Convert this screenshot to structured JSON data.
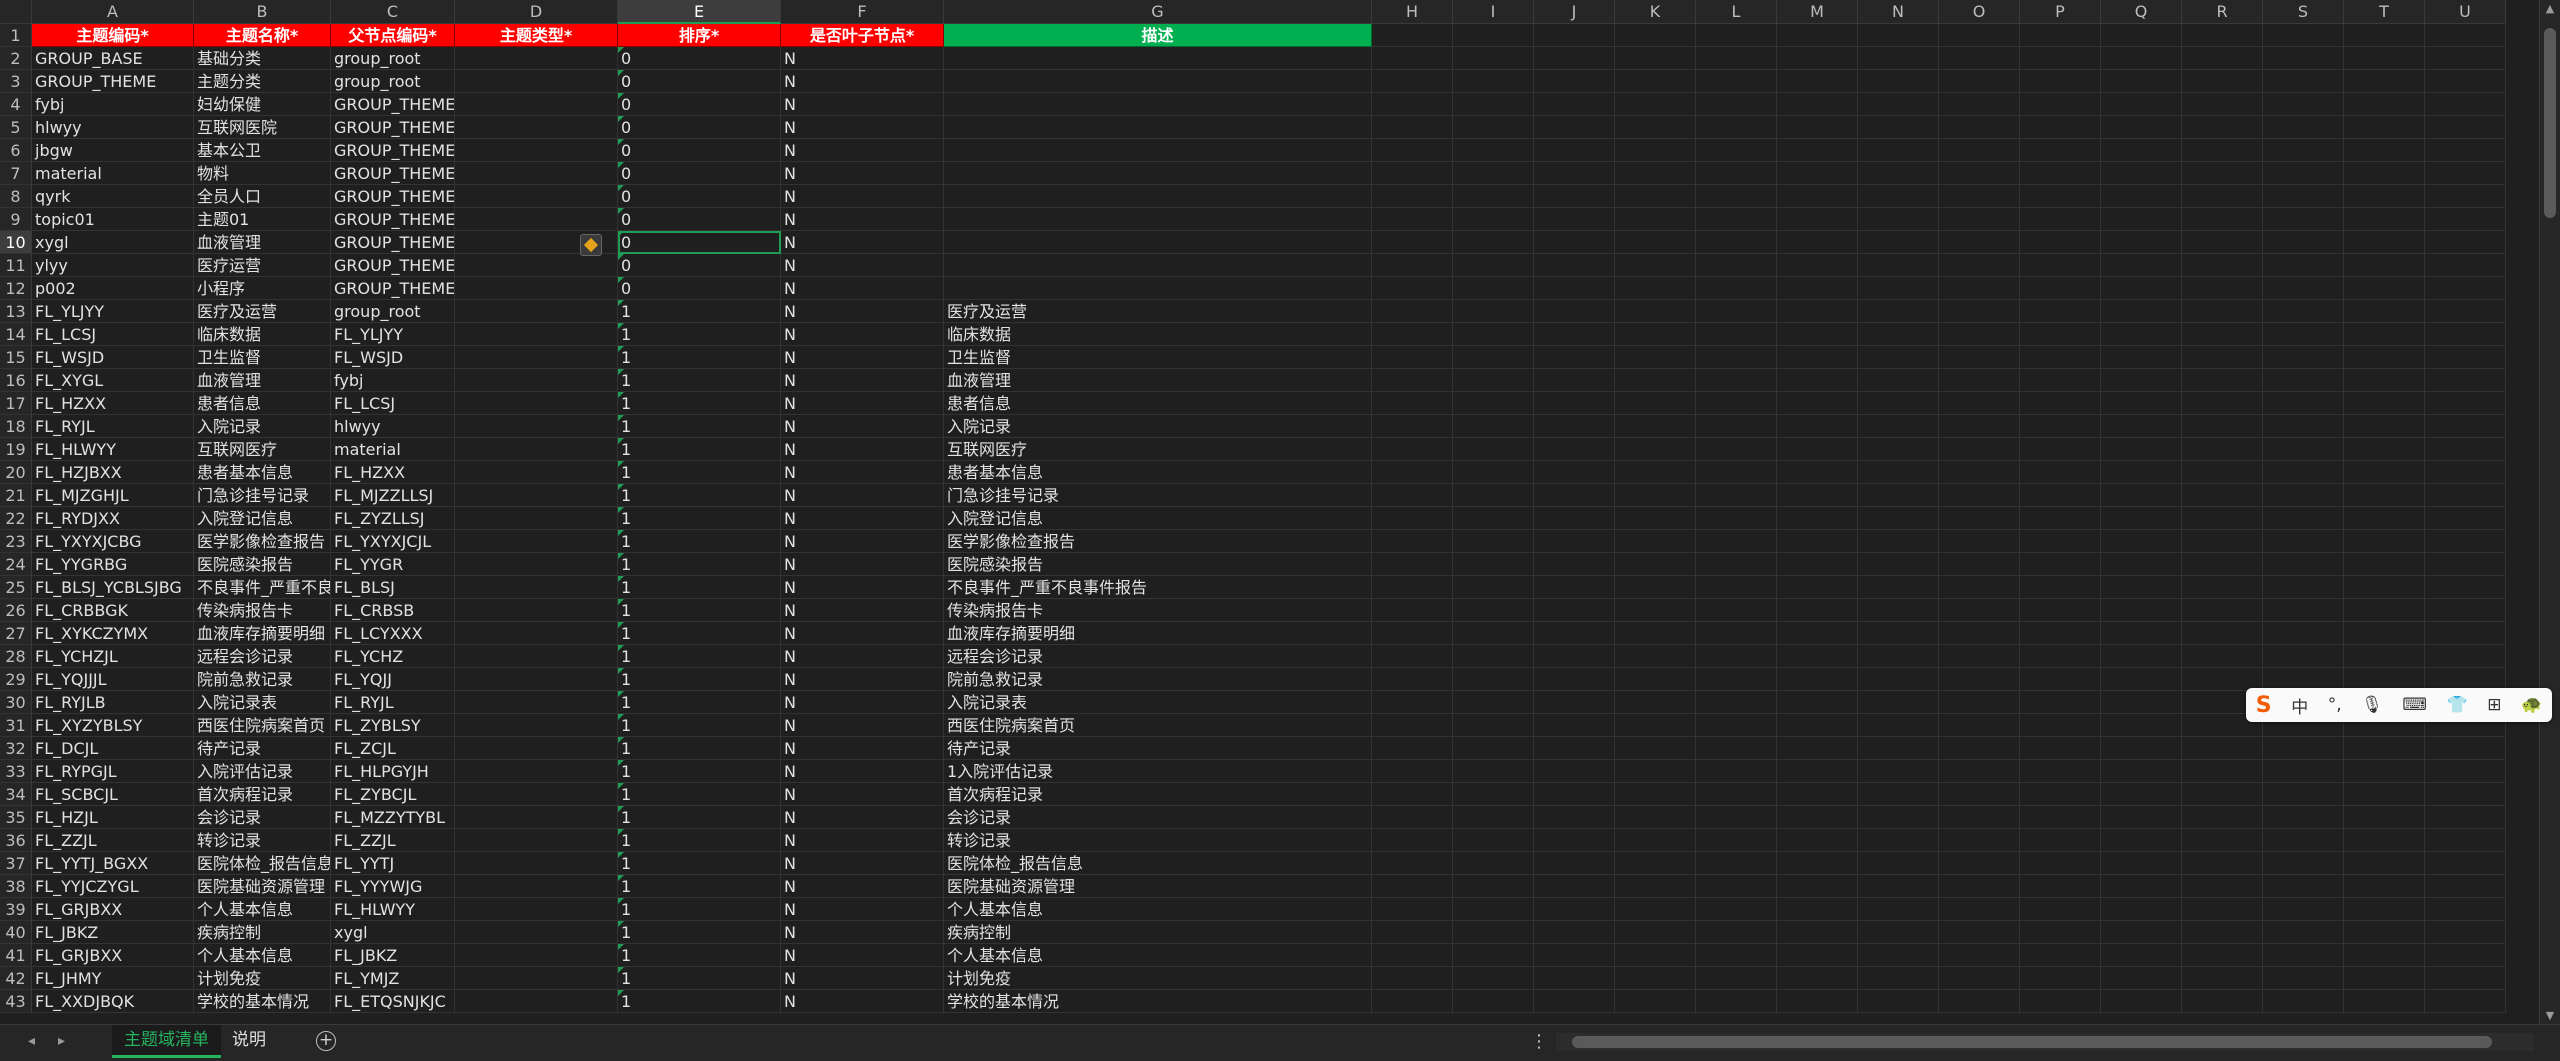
{
  "columns": [
    "A",
    "B",
    "C",
    "D",
    "E",
    "F",
    "G",
    "H",
    "I",
    "J",
    "K",
    "L",
    "M",
    "N",
    "O",
    "P",
    "Q",
    "R",
    "S",
    "T",
    "U"
  ],
  "selected_col": "E",
  "selected_row": "10",
  "header_row": {
    "num": "1",
    "cells": [
      "主题编码*",
      "主题名称*",
      "父节点编码*",
      "主题类型*",
      "排序*",
      "是否叶子节点*",
      "描述"
    ]
  },
  "rows": [
    {
      "n": "2",
      "a": "GROUP_BASE",
      "b": "基础分类",
      "c": "group_root",
      "d": "",
      "e": "0",
      "f": "N",
      "g": ""
    },
    {
      "n": "3",
      "a": "GROUP_THEME",
      "b": "主题分类",
      "c": "group_root",
      "d": "",
      "e": "0",
      "f": "N",
      "g": ""
    },
    {
      "n": "4",
      "a": "fybj",
      "b": "妇幼保健",
      "c": "GROUP_THEME",
      "d": "",
      "e": "0",
      "f": "N",
      "g": ""
    },
    {
      "n": "5",
      "a": "hlwyy",
      "b": "互联网医院",
      "c": "GROUP_THEME",
      "d": "",
      "e": "0",
      "f": "N",
      "g": ""
    },
    {
      "n": "6",
      "a": "jbgw",
      "b": "基本公卫",
      "c": "GROUP_THEME",
      "d": "",
      "e": "0",
      "f": "N",
      "g": ""
    },
    {
      "n": "7",
      "a": "material",
      "b": "物料",
      "c": "GROUP_THEME",
      "d": "",
      "e": "0",
      "f": "N",
      "g": ""
    },
    {
      "n": "8",
      "a": "qyrk",
      "b": "全员人口",
      "c": "GROUP_THEME",
      "d": "",
      "e": "0",
      "f": "N",
      "g": ""
    },
    {
      "n": "9",
      "a": "topic01",
      "b": "主题01",
      "c": "GROUP_THEME",
      "d": "",
      "e": "0",
      "f": "N",
      "g": ""
    },
    {
      "n": "10",
      "a": "xygl",
      "b": "血液管理",
      "c": "GROUP_THEME",
      "d": "",
      "e": "0",
      "f": "N",
      "g": ""
    },
    {
      "n": "11",
      "a": "ylyy",
      "b": "医疗运营",
      "c": "GROUP_THEME",
      "d": "",
      "e": "0",
      "f": "N",
      "g": ""
    },
    {
      "n": "12",
      "a": "p002",
      "b": "小程序",
      "c": "GROUP_THEME",
      "d": "",
      "e": "0",
      "f": "N",
      "g": ""
    },
    {
      "n": "13",
      "a": "FL_YLJYY",
      "b": "医疗及运营",
      "c": "group_root",
      "d": "",
      "e": "1",
      "f": "N",
      "g": "医疗及运营"
    },
    {
      "n": "14",
      "a": "FL_LCSJ",
      "b": "临床数据",
      "c": "FL_YLJYY",
      "d": "",
      "e": "1",
      "f": "N",
      "g": "临床数据"
    },
    {
      "n": "15",
      "a": "FL_WSJD",
      "b": "卫生监督",
      "c": "FL_WSJD",
      "d": "",
      "e": "1",
      "f": "N",
      "g": "卫生监督"
    },
    {
      "n": "16",
      "a": "FL_XYGL",
      "b": "血液管理",
      "c": "fybj",
      "d": "",
      "e": "1",
      "f": "N",
      "g": "血液管理"
    },
    {
      "n": "17",
      "a": "FL_HZXX",
      "b": "患者信息",
      "c": "FL_LCSJ",
      "d": "",
      "e": "1",
      "f": "N",
      "g": "患者信息"
    },
    {
      "n": "18",
      "a": "FL_RYJL",
      "b": "入院记录",
      "c": "hlwyy",
      "d": "",
      "e": "1",
      "f": "N",
      "g": "入院记录"
    },
    {
      "n": "19",
      "a": "FL_HLWYY",
      "b": "互联网医疗",
      "c": "material",
      "d": "",
      "e": "1",
      "f": "N",
      "g": "互联网医疗"
    },
    {
      "n": "20",
      "a": "FL_HZJBXX",
      "b": "患者基本信息",
      "c": "FL_HZXX",
      "d": "",
      "e": "1",
      "f": "N",
      "g": "患者基本信息"
    },
    {
      "n": "21",
      "a": "FL_MJZGHJL",
      "b": "门急诊挂号记录",
      "c": "FL_MJZZLLSJ",
      "d": "",
      "e": "1",
      "f": "N",
      "g": "门急诊挂号记录"
    },
    {
      "n": "22",
      "a": "FL_RYDJXX",
      "b": "入院登记信息",
      "c": "FL_ZYZLLSJ",
      "d": "",
      "e": "1",
      "f": "N",
      "g": "入院登记信息"
    },
    {
      "n": "23",
      "a": "FL_YXYXJCBG",
      "b": "医学影像检查报告",
      "c": "FL_YXYXJCJL",
      "d": "",
      "e": "1",
      "f": "N",
      "g": "医学影像检查报告"
    },
    {
      "n": "24",
      "a": "FL_YYGRBG",
      "b": "医院感染报告",
      "c": "FL_YYGR",
      "d": "",
      "e": "1",
      "f": "N",
      "g": "医院感染报告"
    },
    {
      "n": "25",
      "a": "FL_BLSJ_YCBLSJBG",
      "b": "不良事件_严重不良事件报告",
      "c": "FL_BLSJ",
      "d": "",
      "e": "1",
      "f": "N",
      "g": "不良事件_严重不良事件报告"
    },
    {
      "n": "26",
      "a": "FL_CRBBGK",
      "b": "传染病报告卡",
      "c": "FL_CRBSB",
      "d": "",
      "e": "1",
      "f": "N",
      "g": "传染病报告卡"
    },
    {
      "n": "27",
      "a": "FL_XYKCZYMX",
      "b": "血液库存摘要明细",
      "c": "FL_LCYXXX",
      "d": "",
      "e": "1",
      "f": "N",
      "g": "血液库存摘要明细"
    },
    {
      "n": "28",
      "a": "FL_YCHZJL",
      "b": "远程会诊记录",
      "c": "FL_YCHZ",
      "d": "",
      "e": "1",
      "f": "N",
      "g": "远程会诊记录"
    },
    {
      "n": "29",
      "a": "FL_YQJJJL",
      "b": "院前急救记录",
      "c": "FL_YQJJ",
      "d": "",
      "e": "1",
      "f": "N",
      "g": "院前急救记录"
    },
    {
      "n": "30",
      "a": "FL_RYJLB",
      "b": "入院记录表",
      "c": "FL_RYJL",
      "d": "",
      "e": "1",
      "f": "N",
      "g": "入院记录表"
    },
    {
      "n": "31",
      "a": "FL_XYZYBLSY",
      "b": "西医住院病案首页",
      "c": "FL_ZYBLSY",
      "d": "",
      "e": "1",
      "f": "N",
      "g": "西医住院病案首页"
    },
    {
      "n": "32",
      "a": "FL_DCJL",
      "b": "待产记录",
      "c": "FL_ZCJL",
      "d": "",
      "e": "1",
      "f": "N",
      "g": "待产记录"
    },
    {
      "n": "33",
      "a": "FL_RYPGJL",
      "b": "入院评估记录",
      "c": "FL_HLPGYJH",
      "d": "",
      "e": "1",
      "f": "N",
      "g": "1入院评估记录"
    },
    {
      "n": "34",
      "a": "FL_SCBCJL",
      "b": "首次病程记录",
      "c": "FL_ZYBCJL",
      "d": "",
      "e": "1",
      "f": "N",
      "g": "首次病程记录"
    },
    {
      "n": "35",
      "a": "FL_HZJL",
      "b": "会诊记录",
      "c": "FL_MZZYTYBL",
      "d": "",
      "e": "1",
      "f": "N",
      "g": "会诊记录"
    },
    {
      "n": "36",
      "a": "FL_ZZJL",
      "b": "转诊记录",
      "c": "FL_ZZJL",
      "d": "",
      "e": "1",
      "f": "N",
      "g": "转诊记录"
    },
    {
      "n": "37",
      "a": "FL_YYTJ_BGXX",
      "b": "医院体检_报告信息",
      "c": "FL_YYTJ",
      "d": "",
      "e": "1",
      "f": "N",
      "g": "医院体检_报告信息"
    },
    {
      "n": "38",
      "a": "FL_YYJCZYGL",
      "b": "医院基础资源管理",
      "c": "FL_YYYWJG",
      "d": "",
      "e": "1",
      "f": "N",
      "g": "医院基础资源管理"
    },
    {
      "n": "39",
      "a": "FL_GRJBXX",
      "b": "个人基本信息",
      "c": "FL_HLWYY",
      "d": "",
      "e": "1",
      "f": "N",
      "g": "个人基本信息"
    },
    {
      "n": "40",
      "a": "FL_JBKZ",
      "b": "疾病控制",
      "c": "xygl",
      "d": "",
      "e": "1",
      "f": "N",
      "g": "疾病控制"
    },
    {
      "n": "41",
      "a": "FL_GRJBXX",
      "b": "个人基本信息",
      "c": "FL_JBKZ",
      "d": "",
      "e": "1",
      "f": "N",
      "g": "个人基本信息"
    },
    {
      "n": "42",
      "a": "FL_JHMY",
      "b": "计划免疫",
      "c": "FL_YMJZ",
      "d": "",
      "e": "1",
      "f": "N",
      "g": "计划免疫"
    },
    {
      "n": "43",
      "a": "FL_XXDJBQK",
      "b": "学校的基本情况",
      "c": "FL_ETQSNJKJC",
      "d": "",
      "e": "1",
      "f": "N",
      "g": "学校的基本情况"
    }
  ],
  "sheet_tabs": [
    "主题域清单",
    "说明"
  ],
  "active_tab": "主题域清单",
  "ime_toolbar": {
    "logo": "S",
    "lang": "中",
    "punct": "°,",
    "mic": "🎙",
    "keyboard": "⌨",
    "skin": "👕",
    "grid": "⊞",
    "extra": "🐢"
  },
  "colors": {
    "header_red": "#ff0000",
    "header_green": "#00b050",
    "accent": "#25b35f",
    "background": "#1f1f1f"
  }
}
